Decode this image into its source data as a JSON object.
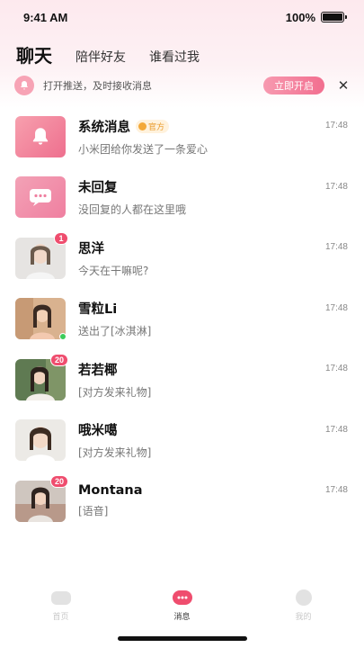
{
  "status_bar": {
    "time": "9:41 AM",
    "battery": "100%"
  },
  "tabs": [
    {
      "label": "聊天",
      "active": true
    },
    {
      "label": "陪伴好友",
      "active": false
    },
    {
      "label": "谁看过我",
      "active": false
    }
  ],
  "notice": {
    "text": "打开推送，及时接收消息",
    "button_label": "立即开启",
    "close_icon": "close-icon",
    "bell_icon": "bell-icon"
  },
  "conversations": [
    {
      "name": "系统消息",
      "tag": "官方",
      "preview": "小米团给你发送了一条爱心",
      "time": "17:48",
      "badge": "",
      "avatar": "bell-icon"
    },
    {
      "name": "未回复",
      "tag": "",
      "preview": "没回复的人都在这里哦",
      "time": "17:48",
      "badge": "",
      "avatar": "chat-bubble-icon"
    },
    {
      "name": "思洋",
      "tag": "",
      "preview": "今天在干嘛呢?",
      "time": "17:48",
      "badge": "1",
      "avatar": "photo"
    },
    {
      "name": "雪粒Li",
      "tag": "",
      "preview": "送出了[冰淇淋]",
      "time": "17:48",
      "badge": "",
      "avatar": "photo",
      "online": true
    },
    {
      "name": "若若椰",
      "tag": "",
      "preview": "[对方发来礼物]",
      "time": "17:48",
      "badge": "20",
      "avatar": "photo"
    },
    {
      "name": "哦米噶",
      "tag": "",
      "preview": "[对方发来礼物]",
      "time": "17:48",
      "badge": "",
      "avatar": "photo"
    },
    {
      "name": "Montana",
      "tag": "",
      "preview": "[语音]",
      "time": "17:48",
      "badge": "20",
      "avatar": "photo"
    }
  ],
  "bottom_nav": [
    {
      "label": "首页",
      "icon": "home-icon",
      "active": false
    },
    {
      "label": "消息",
      "icon": "message-icon",
      "active": true
    },
    {
      "label": "我的",
      "icon": "profile-icon",
      "active": false
    }
  ],
  "colors": {
    "accent": "#ef4d6e",
    "badge": "#ef4d6e",
    "online": "#3dcc5a",
    "official_tag_bg": "#fff2dd",
    "official_tag_text": "#e99a2a"
  }
}
